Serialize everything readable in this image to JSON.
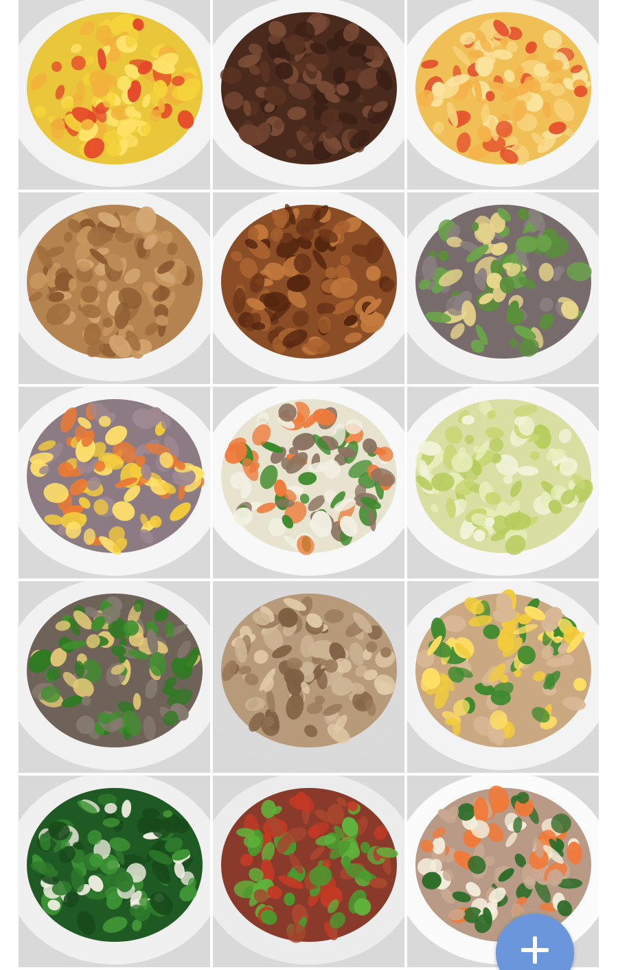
{
  "gallery": {
    "photos": [
      {
        "dish": "corn-with-carrot",
        "plate": "#f3f3f3",
        "base": "#e9c63a",
        "bits": [
          "#f5d33b",
          "#ffe36a",
          "#e5482a",
          "#f2b23c"
        ]
      },
      {
        "dish": "braised-pork",
        "plate": "#f4f4f4",
        "base": "#4a2a1d",
        "bits": [
          "#5a3322",
          "#6e4230",
          "#3b2016",
          "#7a4c36"
        ]
      },
      {
        "dish": "tomato-egg",
        "plate": "#f6f6f6",
        "base": "#f0c057",
        "bits": [
          "#f7d27a",
          "#e5552f",
          "#f4b24a",
          "#fbe39d"
        ]
      },
      {
        "dish": "braised-tofu",
        "plate": "#f2f2f2",
        "base": "#b5834f",
        "bits": [
          "#c7955e",
          "#a06d3d",
          "#d4a774",
          "#8c5a30"
        ]
      },
      {
        "dish": "fried-pork-slices",
        "plate": "#f4f4f4",
        "base": "#8b4d26",
        "bits": [
          "#a9622f",
          "#6d3519",
          "#c57b3e",
          "#55260f"
        ]
      },
      {
        "dish": "liver-with-peas",
        "plate": "#f2f2f2",
        "base": "#786b6c",
        "bits": [
          "#8a7f80",
          "#5a8f3a",
          "#6ba44a",
          "#e9d68c"
        ]
      },
      {
        "dish": "diced-meat-corn",
        "plate": "#f5f5f5",
        "base": "#8d7b83",
        "bits": [
          "#f3cb3c",
          "#ea7a34",
          "#9e8891",
          "#ffe06b"
        ]
      },
      {
        "dish": "cauliflower-pork",
        "plate": "#f8f8f8",
        "base": "#e7e3cf",
        "bits": [
          "#f2f0e2",
          "#8b7362",
          "#3d8a2c",
          "#ee7a3a"
        ]
      },
      {
        "dish": "napa-cabbage",
        "plate": "#f7f7f7",
        "base": "#d9dfa2",
        "bits": [
          "#e8eebb",
          "#c8d774",
          "#f1f3d8",
          "#b6cc5d"
        ]
      },
      {
        "dish": "beef-snow-peas",
        "plate": "#f1f1f1",
        "base": "#6e6259",
        "bits": [
          "#857a70",
          "#3f8f2e",
          "#2f7a22",
          "#e3c978"
        ]
      },
      {
        "dish": "braised-chicken",
        "plate": "#dadada",
        "base": "#b69a7a",
        "bits": [
          "#cdb595",
          "#9a7a5a",
          "#e2cba9",
          "#806043"
        ]
      },
      {
        "dish": "pork-corn-scallion",
        "plate": "#f3f3f3",
        "base": "#c9a882",
        "bits": [
          "#f2cc3b",
          "#3d8a2e",
          "#d9b896",
          "#ffdf63"
        ]
      },
      {
        "dish": "spinach-garlic",
        "plate": "#f0f0f0",
        "base": "#1f5a24",
        "bits": [
          "#2f7a2c",
          "#184a1b",
          "#3f9535",
          "#f3efe3"
        ]
      },
      {
        "dish": "pork-green-pepper",
        "plate": "#ececec",
        "base": "#8a3a2a",
        "bits": [
          "#4a9a2f",
          "#a8462f",
          "#c33a24",
          "#5fb23c"
        ]
      },
      {
        "dish": "pork-cauliflower-greens",
        "plate": "#fbfbfb",
        "base": "#b89a86",
        "bits": [
          "#2f6d2a",
          "#f4eedc",
          "#f07a3a",
          "#c8a890"
        ]
      }
    ]
  },
  "fab": {
    "icon": "plus-icon",
    "color": "#6b96dc"
  }
}
